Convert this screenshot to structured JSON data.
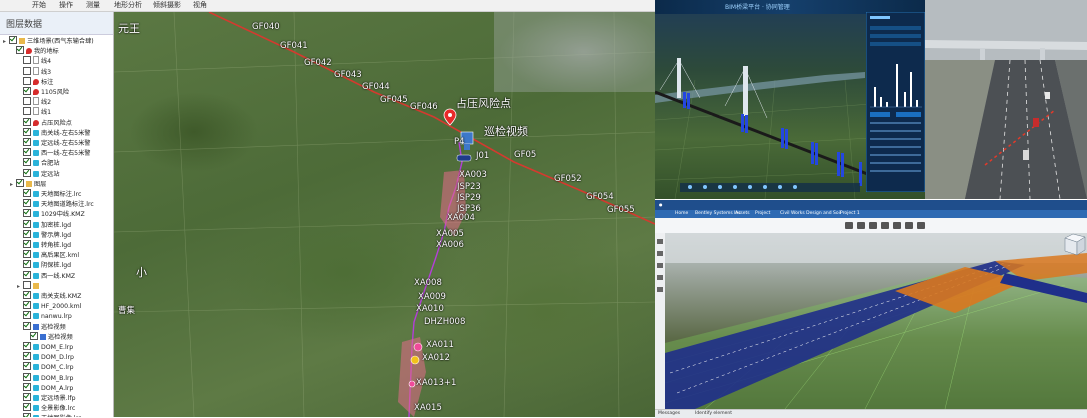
{
  "gis": {
    "menu": [
      "开始",
      "操作",
      "测量",
      "地形分析",
      "倾斜摄影",
      "视角"
    ],
    "panel_title": "图层数据",
    "tree": [
      {
        "label": "三维场景(西气东输合肆)",
        "checked": true,
        "icon": "folder",
        "indent": 0
      },
      {
        "label": "我的地标",
        "checked": true,
        "icon": "red",
        "indent": 1
      },
      {
        "label": "线4",
        "checked": false,
        "icon": "file",
        "indent": 2
      },
      {
        "label": "线3",
        "checked": false,
        "icon": "file",
        "indent": 2
      },
      {
        "label": "标注",
        "checked": false,
        "icon": "red",
        "indent": 2
      },
      {
        "label": "1105风险",
        "checked": true,
        "icon": "red",
        "indent": 2
      },
      {
        "label": "线2",
        "checked": false,
        "icon": "file",
        "indent": 2
      },
      {
        "label": "线1",
        "checked": false,
        "icon": "file",
        "indent": 2
      },
      {
        "label": "占压风险点",
        "checked": true,
        "icon": "red",
        "indent": 2
      },
      {
        "label": "南关线-左右5米警",
        "checked": true,
        "icon": "cyan",
        "indent": 2
      },
      {
        "label": "定远线-左右5米警",
        "checked": true,
        "icon": "cyan",
        "indent": 2
      },
      {
        "label": "西一线-左右5米警",
        "checked": true,
        "icon": "cyan",
        "indent": 2
      },
      {
        "label": "合肥站",
        "checked": true,
        "icon": "cyan",
        "indent": 2
      },
      {
        "label": "定远站",
        "checked": true,
        "icon": "cyan",
        "indent": 2
      },
      {
        "label": "图层",
        "checked": true,
        "icon": "folder",
        "indent": 1
      },
      {
        "label": "天地图标注.lrc",
        "checked": true,
        "icon": "cyan",
        "indent": 2
      },
      {
        "label": "天地图道路标注.lrc",
        "checked": true,
        "icon": "cyan",
        "indent": 2
      },
      {
        "label": "1029中线.KMZ",
        "checked": true,
        "icon": "cyan",
        "indent": 2
      },
      {
        "label": "加密桩.lgd",
        "checked": true,
        "icon": "cyan",
        "indent": 2
      },
      {
        "label": "警示牌.lgd",
        "checked": true,
        "icon": "cyan",
        "indent": 2
      },
      {
        "label": "转角桩.lgd",
        "checked": true,
        "icon": "cyan",
        "indent": 2
      },
      {
        "label": "高后果区.kml",
        "checked": true,
        "icon": "cyan",
        "indent": 2
      },
      {
        "label": "阴保桩.lgd",
        "checked": true,
        "icon": "cyan",
        "indent": 2
      },
      {
        "label": "西一线.KMZ",
        "checked": true,
        "icon": "cyan",
        "indent": 2
      },
      {
        "label": "",
        "checked": false,
        "icon": "folder",
        "indent": 2
      },
      {
        "label": "南关支线.KMZ",
        "checked": true,
        "icon": "cyan",
        "indent": 2
      },
      {
        "label": "HF_2000.kml",
        "checked": true,
        "icon": "cyan",
        "indent": 2
      },
      {
        "label": "nanwu.lrp",
        "checked": true,
        "icon": "cyan",
        "indent": 2
      },
      {
        "label": "巡检视频",
        "checked": true,
        "icon": "blue",
        "indent": 2
      },
      {
        "label": "巡检视频",
        "checked": true,
        "icon": "blue",
        "indent": 3
      },
      {
        "label": "DOM_E.lrp",
        "checked": true,
        "icon": "cyan",
        "indent": 2
      },
      {
        "label": "DOM_D.lrp",
        "checked": true,
        "icon": "cyan",
        "indent": 2
      },
      {
        "label": "DOM_C.lrp",
        "checked": true,
        "icon": "cyan",
        "indent": 2
      },
      {
        "label": "DOM_B.lrp",
        "checked": true,
        "icon": "cyan",
        "indent": 2
      },
      {
        "label": "DOM_A.lrp",
        "checked": true,
        "icon": "cyan",
        "indent": 2
      },
      {
        "label": "定远场景.lfp",
        "checked": true,
        "icon": "cyan",
        "indent": 2
      },
      {
        "label": "全景影像.lrc",
        "checked": true,
        "icon": "cyan",
        "indent": 2
      },
      {
        "label": "天地图影像.lrc",
        "checked": true,
        "icon": "cyan",
        "indent": 2
      }
    ],
    "map": {
      "city_label": "元王",
      "village_label": "小",
      "village_label2": "曹集",
      "risk_label": "占压风险点",
      "video_label": "巡检视频",
      "gf_labels": [
        "GF040",
        "GF041",
        "GF042",
        "GF043",
        "GF044",
        "GF045",
        "GF046",
        "GF05",
        "GF052",
        "GF054",
        "GF055"
      ],
      "route_labels": [
        "P4",
        "J01",
        "XA003",
        "JSP23",
        "JSP29",
        "JSP36",
        "XA004",
        "XA005",
        "XA006",
        "XA008",
        "XA009",
        "XA010",
        "DHZH008",
        "XA011",
        "XA012",
        "XA013+1",
        "XA015"
      ]
    }
  },
  "bridge": {
    "title": "BIM桥梁平台 · 协同管理"
  },
  "highway": {},
  "design": {
    "tabs": [
      "Home",
      "Bentley Systems Inc",
      "Assets",
      "Project",
      "Civil Works Design and Soil",
      "Project 1"
    ],
    "status_left": "Messages",
    "status_right": "Identify element"
  },
  "colors": {
    "pipeline_red": "#d43a2f",
    "pipeline_purple": "#b43ed8",
    "dashboard_bg": "#0d2a4d",
    "road_blue": "#1f2f8a",
    "road_orange": "#d9781f",
    "road_green": "#7fcf5a"
  }
}
